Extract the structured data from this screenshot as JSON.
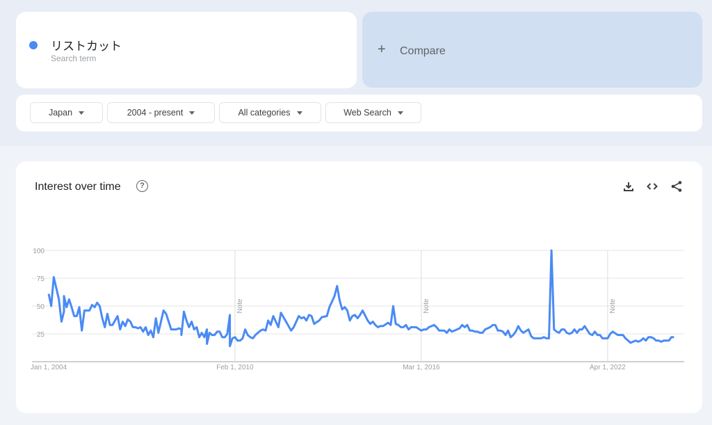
{
  "search_term": {
    "name": "リストカット",
    "subtitle": "Search term",
    "color": "#4a8af4"
  },
  "compare": {
    "icon": "plus-icon",
    "label": "Compare"
  },
  "filters": [
    {
      "label": "Japan"
    },
    {
      "label": "2004 - present"
    },
    {
      "label": "All categories"
    },
    {
      "label": "Web Search"
    }
  ],
  "panel": {
    "title": "Interest over time",
    "help_icon": "help-circle-icon",
    "actions": [
      "download-icon",
      "embed-code-icon",
      "share-icon"
    ]
  },
  "chart_data": {
    "type": "line",
    "title": "Interest over time",
    "xlabel": "",
    "ylabel": "",
    "ylim": [
      0,
      100
    ],
    "yticks": [
      25,
      50,
      75,
      100
    ],
    "grid": true,
    "line_color": "#4a8af4",
    "x_axis": {
      "unit": "months since Jan 2004",
      "range": [
        0,
        249
      ],
      "ticks": [
        {
          "label": "Jan 1, 2004",
          "month": 0
        },
        {
          "label": "Feb 1, 2010",
          "month": 73
        },
        {
          "label": "Mar 1, 2016",
          "month": 146
        },
        {
          "label": "Apr 1, 2022",
          "month": 219
        }
      ]
    },
    "notes": [
      {
        "label": "Note",
        "month": 73
      },
      {
        "label": "Note",
        "month": 146
      },
      {
        "label": "Note",
        "month": 219
      }
    ],
    "series": [
      {
        "name": "リストカット",
        "months": [
          0,
          1,
          2,
          4,
          5,
          6,
          6,
          7,
          8,
          9,
          10,
          11,
          12,
          13,
          14,
          16,
          17,
          18,
          19,
          20,
          21,
          22,
          23,
          24,
          25,
          27,
          28,
          29,
          30,
          31,
          32,
          33,
          34,
          35,
          36,
          37,
          38,
          39,
          40,
          41,
          42,
          43,
          45,
          46,
          48,
          50,
          51,
          52,
          52,
          53,
          54,
          55,
          56,
          57,
          58,
          59,
          60,
          61,
          62,
          62,
          63,
          64,
          65,
          66,
          67,
          68,
          69,
          70,
          71,
          71,
          72,
          73,
          74,
          75,
          76,
          77,
          78,
          79,
          80,
          81,
          83,
          84,
          85,
          86,
          87,
          88,
          90,
          91,
          93,
          94,
          95,
          96,
          97,
          98,
          99,
          100,
          101,
          102,
          103,
          104,
          106,
          107,
          109,
          110,
          112,
          113,
          114,
          115,
          116,
          117,
          118,
          119,
          120,
          121,
          122,
          123,
          125,
          126,
          127,
          128,
          129,
          130,
          131,
          133,
          134,
          135,
          136,
          137,
          138,
          139,
          140,
          141,
          142,
          144,
          146,
          147,
          148,
          149,
          151,
          152,
          153,
          154,
          155,
          156,
          157,
          158,
          160,
          161,
          162,
          163,
          164,
          165,
          166,
          167,
          168,
          169,
          170,
          171,
          173,
          174,
          175,
          176,
          177,
          178,
          179,
          180,
          181,
          182,
          183,
          184,
          185,
          186,
          188,
          189,
          190,
          192,
          193,
          194,
          195,
          196,
          197,
          198,
          199,
          200,
          201,
          202,
          203,
          204,
          205,
          206,
          207,
          208,
          209,
          210,
          212,
          213,
          214,
          215,
          216,
          217,
          218,
          219,
          220,
          221,
          223,
          224,
          225,
          226,
          227,
          228,
          229,
          230,
          231,
          232,
          233,
          234,
          235,
          236,
          237,
          238,
          239,
          240,
          241,
          242,
          243,
          244,
          245,
          246,
          247,
          248
        ],
        "values": [
          61,
          50,
          76,
          56,
          36,
          45,
          59,
          49,
          56,
          49,
          41,
          41,
          49,
          28,
          46,
          46,
          51,
          49,
          53,
          50,
          39,
          31,
          43,
          33,
          33,
          41,
          29,
          36,
          32,
          38,
          36,
          31,
          31,
          30,
          31,
          27,
          31,
          24,
          28,
          22,
          39,
          26,
          46,
          43,
          29,
          29,
          30,
          29,
          24,
          45,
          37,
          31,
          36,
          29,
          31,
          22,
          26,
          22,
          29,
          16,
          26,
          24,
          24,
          27,
          27,
          22,
          22,
          25,
          42,
          14,
          21,
          22,
          19,
          19,
          21,
          29,
          24,
          22,
          21,
          24,
          28,
          29,
          28,
          37,
          33,
          41,
          31,
          44,
          36,
          32,
          28,
          31,
          36,
          41,
          39,
          40,
          37,
          42,
          41,
          34,
          37,
          40,
          41,
          49,
          59,
          68,
          55,
          47,
          49,
          46,
          37,
          41,
          42,
          39,
          42,
          46,
          37,
          34,
          36,
          33,
          31,
          32,
          32,
          35,
          33,
          50,
          34,
          33,
          31,
          31,
          33,
          29,
          31,
          31,
          28,
          29,
          29,
          31,
          33,
          31,
          28,
          28,
          28,
          26,
          29,
          27,
          29,
          30,
          33,
          31,
          33,
          28,
          28,
          27,
          27,
          26,
          26,
          29,
          31,
          33,
          33,
          28,
          28,
          27,
          24,
          28,
          22,
          24,
          27,
          32,
          28,
          26,
          29,
          23,
          21,
          21,
          21,
          22,
          21,
          21,
          100,
          29,
          27,
          26,
          29,
          29,
          26,
          25,
          26,
          29,
          26,
          29,
          29,
          32,
          25,
          24,
          27,
          24,
          24,
          21,
          21,
          21,
          25,
          27,
          24,
          24,
          24,
          21,
          19,
          17,
          18,
          19,
          18,
          19,
          21,
          19,
          22,
          22,
          21,
          19,
          19,
          18,
          19,
          19,
          19,
          22,
          22
        ]
      }
    ]
  }
}
